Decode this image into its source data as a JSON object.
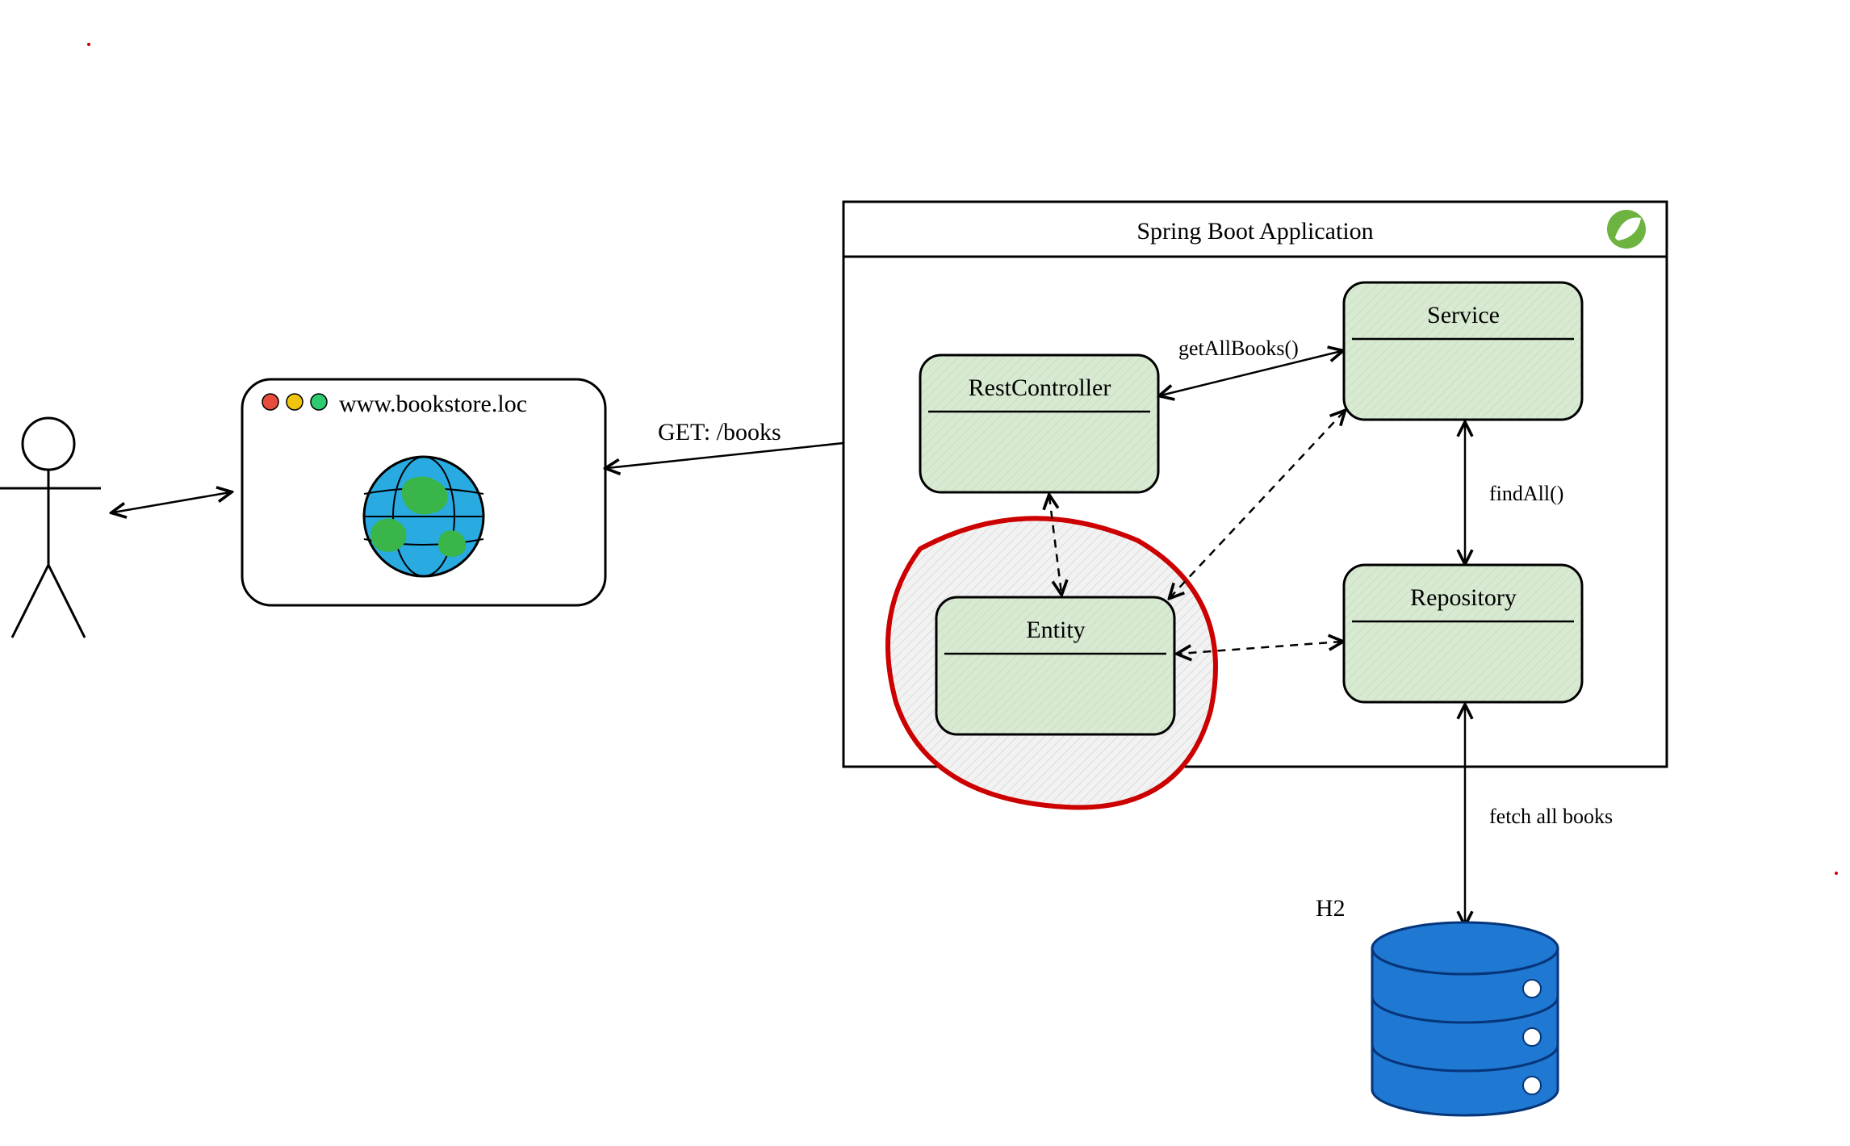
{
  "app": {
    "title": "Spring Boot Application"
  },
  "browser": {
    "url": "www.bookstore.loc"
  },
  "labels": {
    "http_request": "GET: /books",
    "get_all_books": "getAllBooks()",
    "find_all": "findAll()",
    "fetch_all": "fetch all books",
    "db_name": "H2"
  },
  "components": {
    "rest_controller": "RestController",
    "service": "Service",
    "repository": "Repository",
    "entity": "Entity"
  },
  "colors": {
    "component_fill": "#d9ead3",
    "highlight_stroke": "#cc0000",
    "highlight_fill": "#f0f0f0",
    "db_fill": "#1f78d1",
    "spring_green": "#6db33f",
    "globe_blue": "#29abe2",
    "globe_green": "#39b54a"
  }
}
